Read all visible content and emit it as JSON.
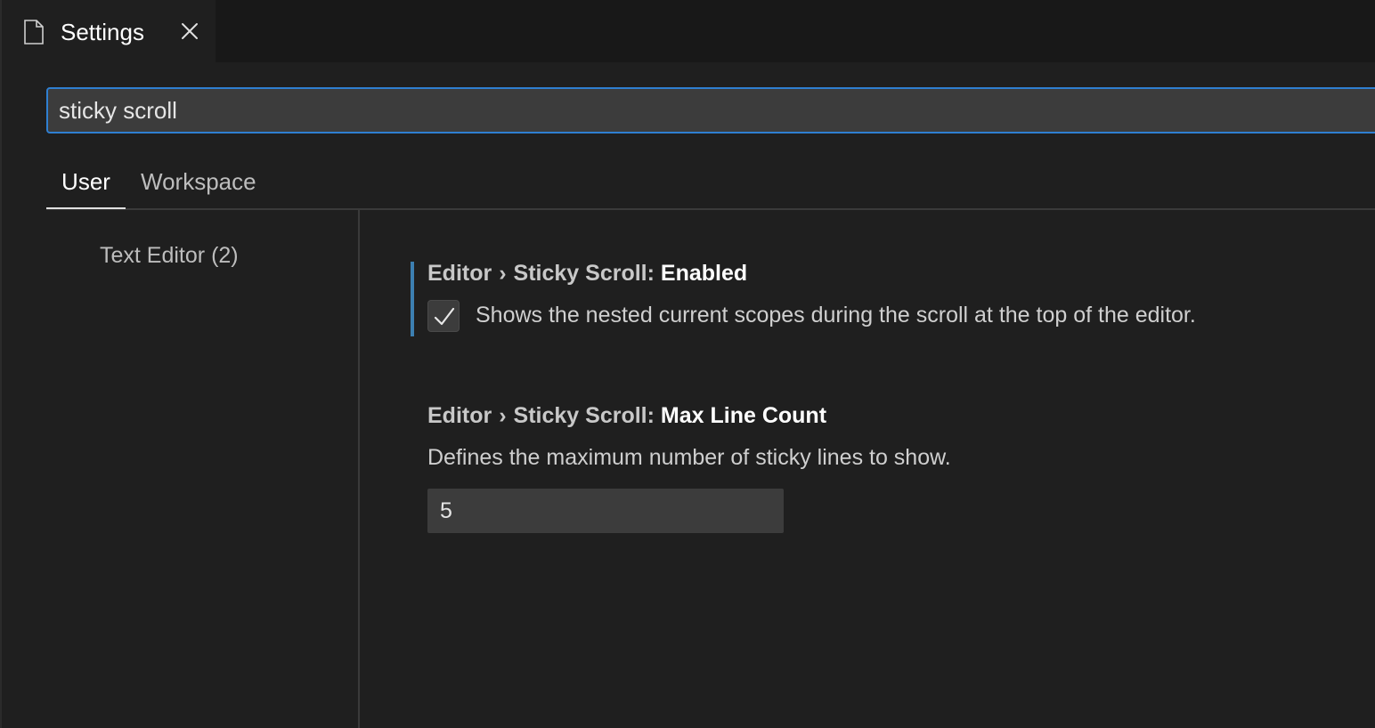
{
  "tab": {
    "label": "Settings",
    "file_icon": "file-icon",
    "close_icon": "close-icon"
  },
  "search": {
    "value": "sticky scroll",
    "placeholder": ""
  },
  "scope_tabs": {
    "user": "User",
    "workspace": "Workspace",
    "selected": "User"
  },
  "toc": {
    "items": [
      {
        "label": "Text Editor",
        "count": "(2)"
      }
    ]
  },
  "settings": [
    {
      "category": "Editor",
      "separator": "›",
      "group": "Sticky Scroll:",
      "key": "Enabled",
      "description": "Shows the nested current scopes during the scroll at the top of the editor.",
      "control": "checkbox",
      "checked": true,
      "check_icon": "checkmark-icon"
    },
    {
      "category": "Editor",
      "separator": "›",
      "group": "Sticky Scroll:",
      "key": "Max Line Count",
      "description": "Defines the maximum number of sticky lines to show.",
      "control": "number",
      "value": "5"
    }
  ],
  "colors": {
    "background": "#1f1f1f",
    "tab_strip": "#181818",
    "focus_border": "#2f7fd1",
    "focus_bar": "#3c7fb1",
    "input_bg": "#3c3c3c"
  }
}
